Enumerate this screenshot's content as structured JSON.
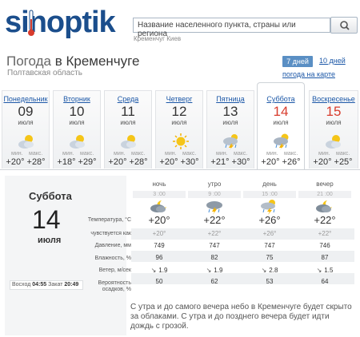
{
  "header": {
    "logo_text": "sinoptik",
    "search_placeholder": "Название населенного пункта, страны или региона",
    "search_hint": "Кременчуг Киев"
  },
  "title": {
    "prefix": "Погода",
    "city": "в Кременчуге"
  },
  "region": "Полтавская область",
  "nav": {
    "seven_days": "7 дней",
    "ten_days": "10 дней",
    "map_link": "погода на карте"
  },
  "days": [
    {
      "name": "Понедельник",
      "date": "09",
      "month": "июля",
      "min_label": "мин.",
      "max_label": "макс.",
      "temp": "+20° +28°",
      "icon": "sun-cloud-icon",
      "weekend": false
    },
    {
      "name": "Вторник",
      "date": "10",
      "month": "июля",
      "min_label": "мин.",
      "max_label": "макс.",
      "temp": "+18° +29°",
      "icon": "sun-cloud-icon",
      "weekend": false
    },
    {
      "name": "Среда",
      "date": "11",
      "month": "июля",
      "min_label": "мин.",
      "max_label": "макс.",
      "temp": "+20° +28°",
      "icon": "sun-cloud-icon",
      "weekend": false
    },
    {
      "name": "Четверг",
      "date": "12",
      "month": "июля",
      "min_label": "мин.",
      "max_label": "макс.",
      "temp": "+20° +30°",
      "icon": "sun-icon",
      "weekend": false
    },
    {
      "name": "Пятница",
      "date": "13",
      "month": "июля",
      "min_label": "мин.",
      "max_label": "макс.",
      "temp": "+21° +30°",
      "icon": "thunderstorm-icon",
      "weekend": false
    },
    {
      "name": "Суббота",
      "date": "14",
      "month": "июля",
      "min_label": "мин.",
      "max_label": "макс.",
      "temp": "+20° +26°",
      "icon": "sun-cloud-rain-icon",
      "weekend": true
    },
    {
      "name": "Воскресенье",
      "date": "15",
      "month": "июля",
      "min_label": "мин.",
      "max_label": "макс.",
      "temp": "+20° +25°",
      "icon": "sun-cloud-icon",
      "weekend": true
    }
  ],
  "selected": {
    "day_name": "Суббота",
    "date": "14",
    "month": "июля",
    "sunrise_label": "Восход",
    "sunrise": "04:55",
    "sunset_label": "Закат",
    "sunset": "20:49"
  },
  "row_labels": {
    "temperature": "Температура, °C",
    "feels_like": "чувствуется как",
    "pressure": "Давление, мм",
    "humidity": "Влажность, %",
    "wind": "Ветер, м/сек",
    "precip": "Вероятность осадков, %"
  },
  "periods": [
    {
      "name": "ночь",
      "time": "3 :00",
      "icon": "cloud-night-icon",
      "temp": "+20°",
      "feels": "+20°",
      "pressure": "749",
      "humidity": "96",
      "wind": "1.9",
      "precip": "50"
    },
    {
      "name": "утро",
      "time": "9 :00",
      "icon": "cloud-rain-icon",
      "temp": "+22°",
      "feels": "+22°",
      "pressure": "747",
      "humidity": "82",
      "wind": "1.9",
      "precip": "62"
    },
    {
      "name": "день",
      "time": "15 :00",
      "icon": "sun-cloud-rain-icon",
      "temp": "+26°",
      "feels": "+26°",
      "pressure": "747",
      "humidity": "75",
      "wind": "2.8",
      "precip": "53"
    },
    {
      "name": "вечер",
      "time": "21 :00",
      "icon": "cloud-night-icon",
      "temp": "+22°",
      "feels": "+22°",
      "pressure": "746",
      "humidity": "87",
      "wind": "1.5",
      "precip": "64"
    }
  ],
  "description": "С утра и до самого вечера небо в Кременчуге будет скрыто за облаками. С утра и до позднего вечера будет идти дождь с грозой.",
  "colors": {
    "logo_blue": "#1b4e8c",
    "link_blue": "#1b57a7",
    "weekend_red": "#d83c2d",
    "active_button": "#5a8fc4"
  }
}
